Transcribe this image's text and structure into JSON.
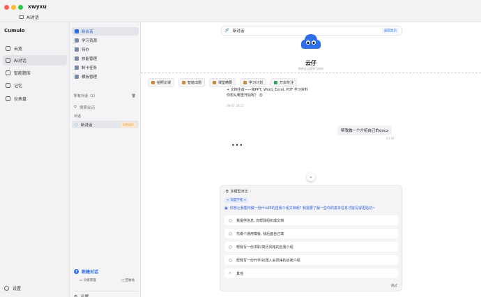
{
  "window": {
    "app_name": "xwyxu",
    "sub_title": "AI对话"
  },
  "left_sidebar": {
    "brand": "Cumulo",
    "items": [
      {
        "label": "云宽",
        "icon": "cloud-icon",
        "active": false
      },
      {
        "label": "AI对话",
        "icon": "chat-icon",
        "active": true
      },
      {
        "label": "智能题库",
        "icon": "graduation-cap-icon",
        "active": false
      },
      {
        "label": "记忆",
        "icon": "folder-icon",
        "active": false
      },
      {
        "label": "仪表盘",
        "icon": "dashboard-icon",
        "active": false
      }
    ],
    "settings_label": "设置"
  },
  "mid_sidebar": {
    "items": [
      {
        "label": "新会话",
        "active": true
      },
      {
        "label": "学习资源",
        "active": false
      },
      {
        "label": "待办",
        "active": false
      },
      {
        "label": "技能管理",
        "active": false
      },
      {
        "label": "制卡任务",
        "active": false
      },
      {
        "label": "模板管理",
        "active": false
      }
    ],
    "all_chats_label": "所有对话（1）",
    "search_placeholder": "搜索会话",
    "group_label": "对话",
    "chat_item": {
      "title": "新对话",
      "badge": "后台运行"
    },
    "new_chat_label": "新建对话",
    "group_manage_label": "分组管理",
    "trash_label": "回收站",
    "settings_label": "设置"
  },
  "main": {
    "topbar_title": "新对话",
    "topbar_back": "返回主页",
    "bot_name": "云仔",
    "bot_subtitle": "你的全过程学习伙伴",
    "toolbar": [
      "拍照识课",
      "智能出题",
      "课堂精要",
      "学习计划",
      "开启专注"
    ],
    "bot_message_line1": "+ 文档生成——做PPT, Word, Excel, PDF 学习资料",
    "bot_message_line2": "你想从哪里开始呢？ 😊",
    "bot_message_time": "08-02 18:21",
    "user_message": "帮我做一个介绍自己的docx",
    "user_message_time": "23:44",
    "typing": "•••",
    "scroll_down_icon": "chevron-down-icon"
  },
  "question_card": {
    "header": "多模型对比",
    "tag": "深度学者",
    "question": "你想让我帮你做一份什么样的自我介绍文档呢? 我需要了解一些你的基本信息才能写得更贴切~",
    "options": [
      "我提供信息, 你帮我组织成文档",
      "先做个通用模板, 我后面自己填",
      "帮我写一份求职/简历风格的自我介绍",
      "帮我写一份开学/社团入会风格的自我介绍",
      "其他"
    ],
    "skip_label": "跳过"
  },
  "colors": {
    "accent": "#2b6cf0",
    "avatar": "#2e6ee8",
    "badge_bg": "#fde9d0"
  }
}
